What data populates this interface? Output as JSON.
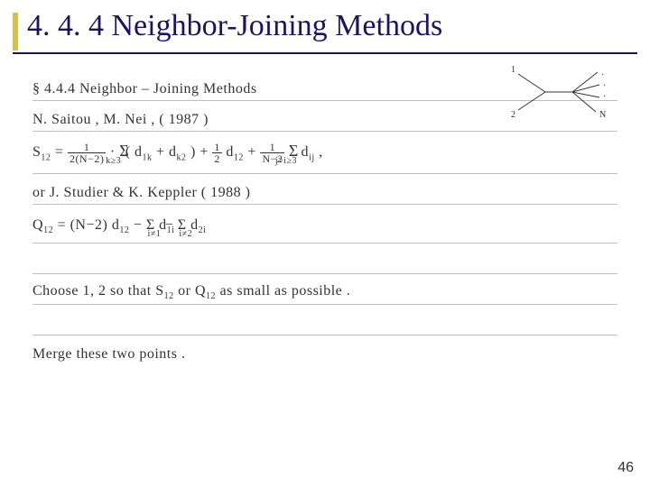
{
  "title": "4. 4. 4 Neighbor-Joining Methods",
  "page_number": "46",
  "notes": {
    "line1": "§ 4.4.4   Neighbor – Joining   Methods",
    "line2": "N. Saitou ,  M. Nei , ( 1987 )",
    "line3_prefix": "S",
    "line3_s_sub": "12",
    "line3_eq": " = ",
    "line3_f1_n": "1",
    "line3_f1_d": "2(N−2)",
    "line3_mid1": " · ",
    "line3_sum1": "Σ",
    "line3_sum1_under": "k≥3",
    "line3_paren": " ( d",
    "line3_d1k": "1k",
    "line3_plus1": " + d",
    "line3_d2k": "k2",
    "line3_close": " )  + ",
    "line3_f2_n": "1",
    "line3_f2_d": "2",
    "line3_d12": " d",
    "line3_d12sub": "12",
    "line3_plus2": "  +  ",
    "line3_f3_n": "1",
    "line3_f3_d": "N−2",
    "line3_sum2": " Σ",
    "line3_sum2_under": "j>i≥3",
    "line3_dij": " d",
    "line3_dij_sub": "ij",
    "line3_comma": " ,",
    "line4": "or   J. Studier  &   K. Keppler  ( 1988 )",
    "line5_prefix": "Q",
    "line5_sub": "12",
    "line5_body1": " = (N−2) d",
    "line5_d12": "12",
    "line5_body2": "  −  Σ d",
    "line5_d1i": "1i",
    "line5_under1": "i≠1",
    "line5_body3": "   −   Σ d",
    "line5_d2i": "2i",
    "line5_under2": "i≠2",
    "line6": "",
    "line7_a": "Choose  1, 2   so  that   S",
    "line7_s": "12",
    "line7_b": "  or  Q",
    "line7_q": "12",
    "line7_c": "   as   small   as   possible .",
    "line8": "",
    "line9": "Merge   these   two   points .",
    "tree_labels": {
      "one": "1",
      "two": "2",
      "n": "N"
    }
  }
}
